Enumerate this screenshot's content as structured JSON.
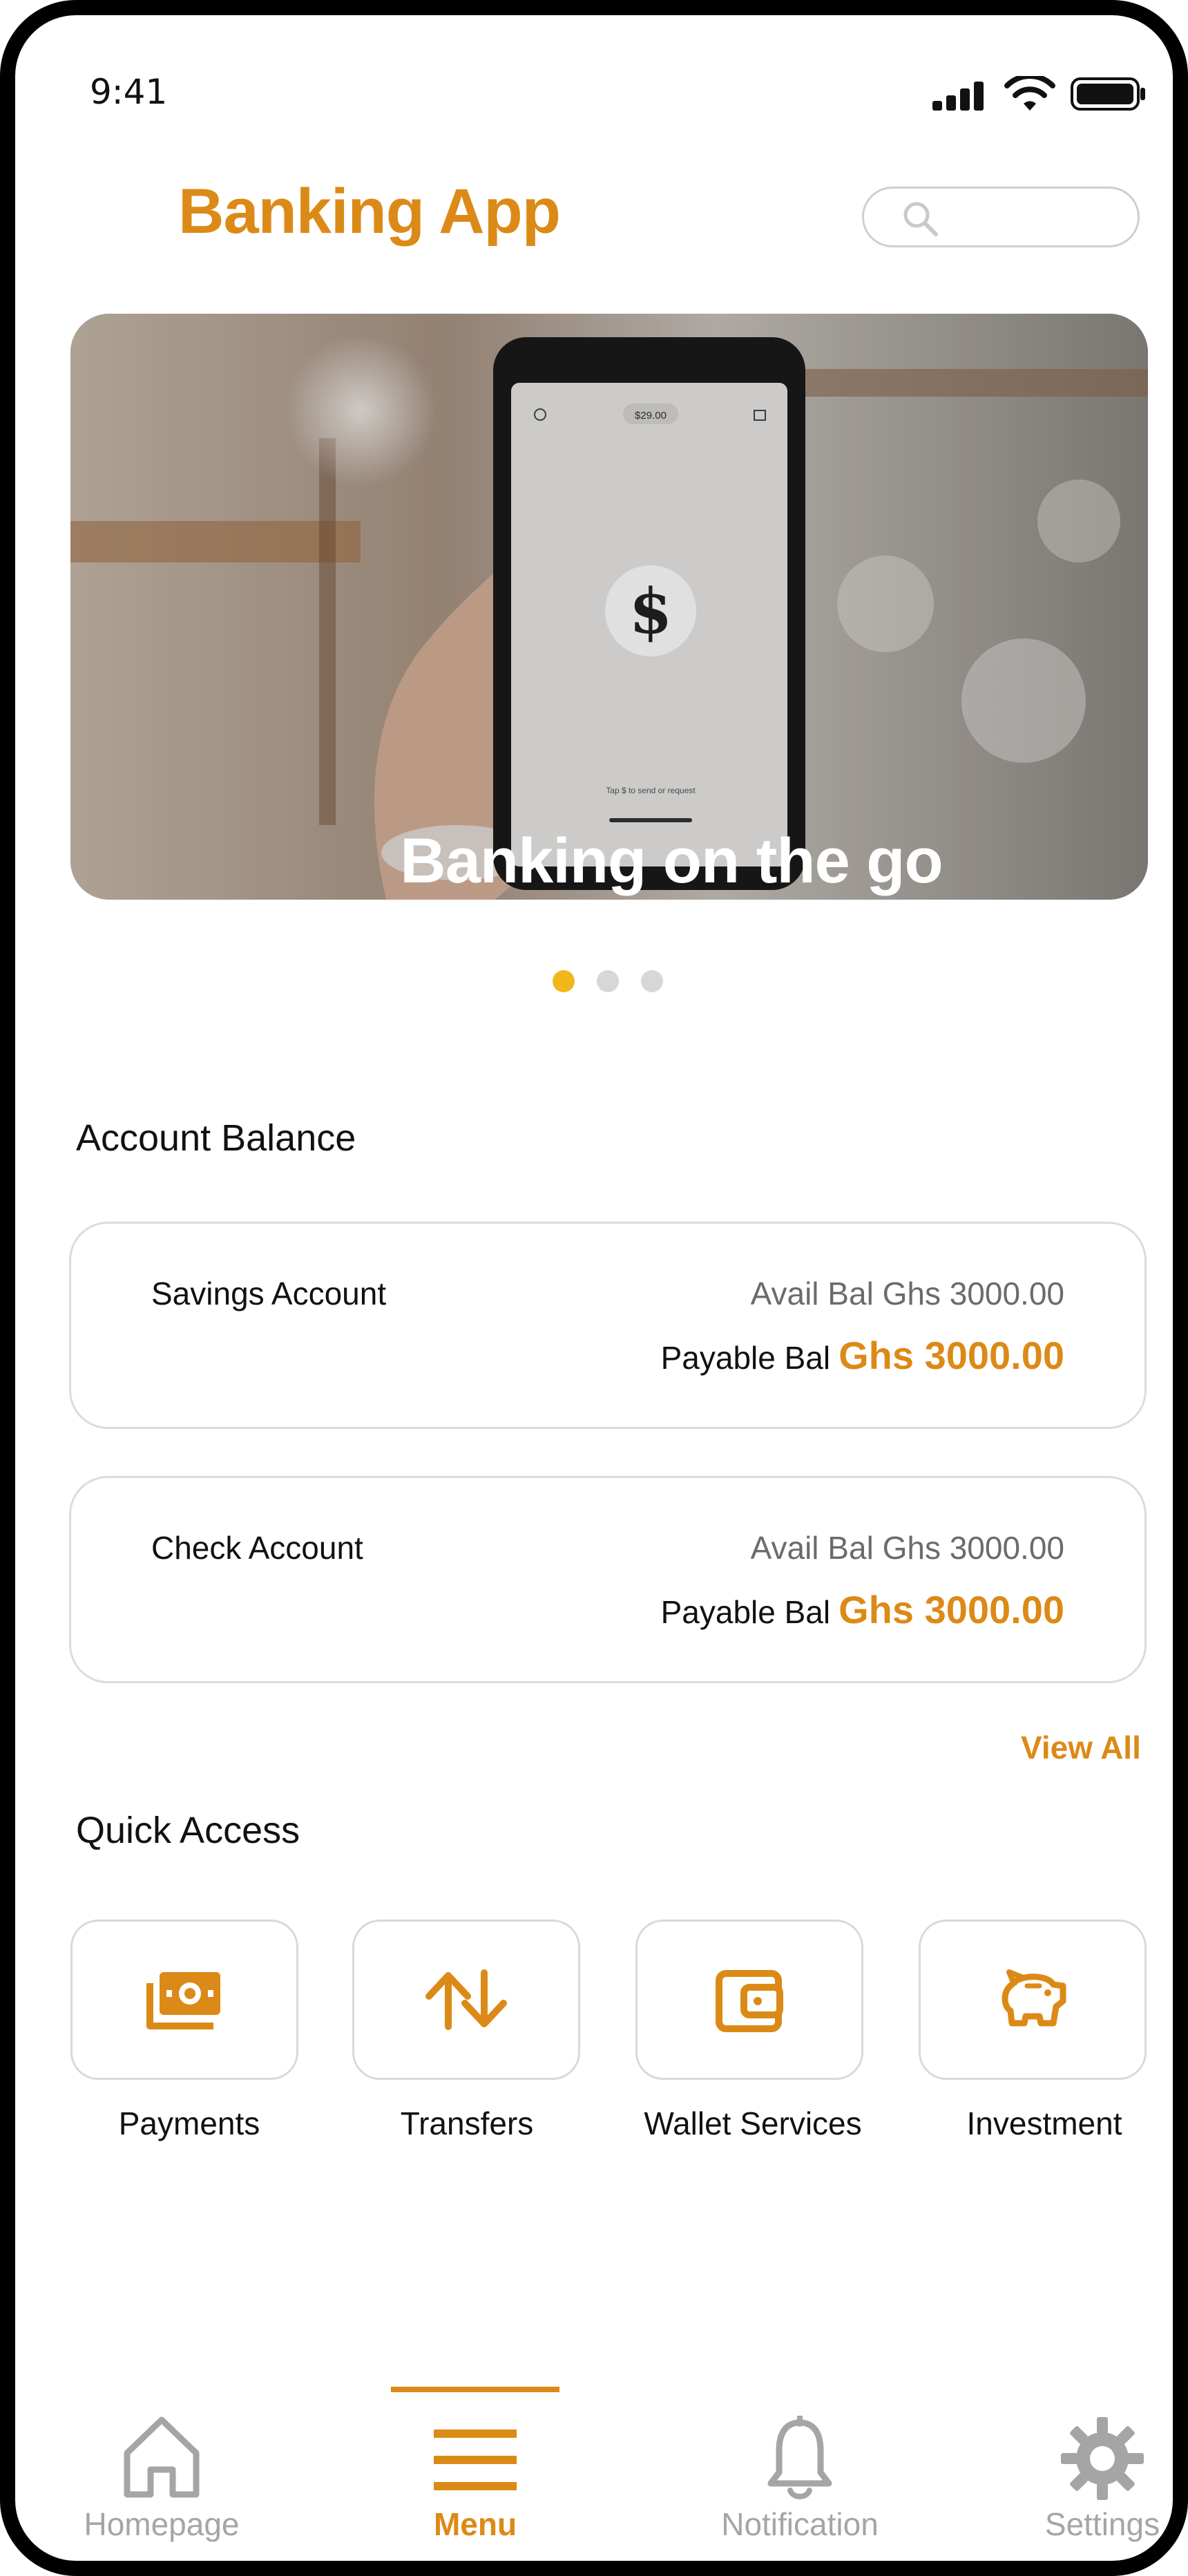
{
  "status_bar": {
    "time": "9:41"
  },
  "header": {
    "title": "Banking App",
    "search_icon": "search-icon"
  },
  "banner": {
    "caption": "Banking on the go",
    "phone_screen": {
      "amount": "$29.00",
      "hint": "Tap $ to send or request"
    },
    "page_indicator": {
      "count": 3,
      "active_index": 0
    }
  },
  "account_balance": {
    "title": "Account Balance",
    "accounts": [
      {
        "name": "Savings Account",
        "avail": "Avail Bal Ghs 3000.00",
        "payable_label": "Payable Bal",
        "payable_value": "Ghs 3000.00"
      },
      {
        "name": "Check Account",
        "avail": "Avail Bal Ghs 3000.00",
        "payable_label": "Payable Bal",
        "payable_value": "Ghs 3000.00"
      }
    ],
    "view_all": "View All"
  },
  "quick_access": {
    "title": "Quick Access",
    "items": [
      {
        "label": "Payments",
        "icon": "money-icon"
      },
      {
        "label": "Transfers",
        "icon": "transfer-arrows-icon"
      },
      {
        "label": "Wallet Services",
        "icon": "wallet-icon"
      },
      {
        "label": "Investment",
        "icon": "piggy-bank-icon"
      }
    ]
  },
  "bottom_nav": {
    "active": "Menu",
    "items": [
      {
        "label": "Homepage",
        "icon": "home-icon"
      },
      {
        "label": "Menu",
        "icon": "menu-icon"
      },
      {
        "label": "Notification",
        "icon": "bell-icon"
      },
      {
        "label": "Settings",
        "icon": "gear-icon"
      }
    ]
  },
  "colors": {
    "accent": "#dc8a17",
    "dot_active": "#f2b81b",
    "inactive": "#a5a5a5",
    "border": "#dcdcdc"
  }
}
